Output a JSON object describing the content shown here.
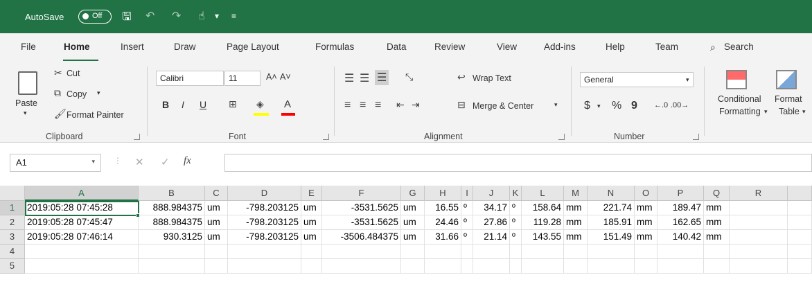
{
  "titlebar": {
    "autosave_label": "AutoSave",
    "toggle_label": "Off"
  },
  "menu": [
    "File",
    "Home",
    "Insert",
    "Draw",
    "Page Layout",
    "Formulas",
    "Data",
    "Review",
    "View",
    "Add-ins",
    "Help",
    "Team",
    "Search"
  ],
  "ribbon": {
    "clipboard": {
      "paste": "Paste",
      "cut": "Cut",
      "copy": "Copy",
      "format_painter": "Format Painter",
      "group": "Clipboard"
    },
    "font": {
      "name": "Calibri",
      "size": "11",
      "group": "Font",
      "bold": "B",
      "italic": "I",
      "underline": "U"
    },
    "alignment": {
      "wrap": "Wrap Text",
      "merge": "Merge & Center",
      "group": "Alignment"
    },
    "number": {
      "format": "General",
      "currency": "$",
      "percent": "%",
      "comma": "9",
      "group": "Number"
    },
    "styles": {
      "conditional_1": "Conditional",
      "conditional_2": "Formatting",
      "format_table_1": "Format",
      "format_table_2": "Table"
    }
  },
  "formula_bar": {
    "name_box": "A1",
    "fx": "fx",
    "value": ""
  },
  "accent": "#217346",
  "columns": [
    "A",
    "B",
    "C",
    "D",
    "E",
    "F",
    "G",
    "H",
    "I",
    "J",
    "K",
    "L",
    "M",
    "N",
    "O",
    "P",
    "Q",
    "R"
  ],
  "rows": [
    {
      "num": "1",
      "cells": [
        "2019:05:28 07:45:28",
        "888.984375",
        "um",
        "-798.203125",
        "um",
        "-3531.5625",
        "um",
        "16.55",
        "º",
        "34.17",
        "º",
        "158.64",
        "mm",
        "221.74",
        "mm",
        "189.47",
        "mm",
        ""
      ]
    },
    {
      "num": "2",
      "cells": [
        "2019:05:28 07:45:47",
        "888.984375",
        "um",
        "-798.203125",
        "um",
        "-3531.5625",
        "um",
        "24.46",
        "º",
        "27.86",
        "º",
        "119.28",
        "mm",
        "185.91",
        "mm",
        "162.65",
        "mm",
        ""
      ]
    },
    {
      "num": "3",
      "cells": [
        "2019:05:28 07:46:14",
        "930.3125",
        "um",
        "-798.203125",
        "um",
        "-3506.484375",
        "um",
        "31.66",
        "º",
        "21.14",
        "º",
        "143.55",
        "mm",
        "151.49",
        "mm",
        "140.42",
        "mm",
        ""
      ]
    },
    {
      "num": "4",
      "cells": [
        "",
        "",
        "",
        "",
        "",
        "",
        "",
        "",
        "",
        "",
        "",
        "",
        "",
        "",
        "",
        "",
        "",
        ""
      ]
    },
    {
      "num": "5",
      "cells": [
        "",
        "",
        "",
        "",
        "",
        "",
        "",
        "",
        "",
        "",
        "",
        "",
        "",
        "",
        "",
        "",
        "",
        ""
      ]
    }
  ]
}
